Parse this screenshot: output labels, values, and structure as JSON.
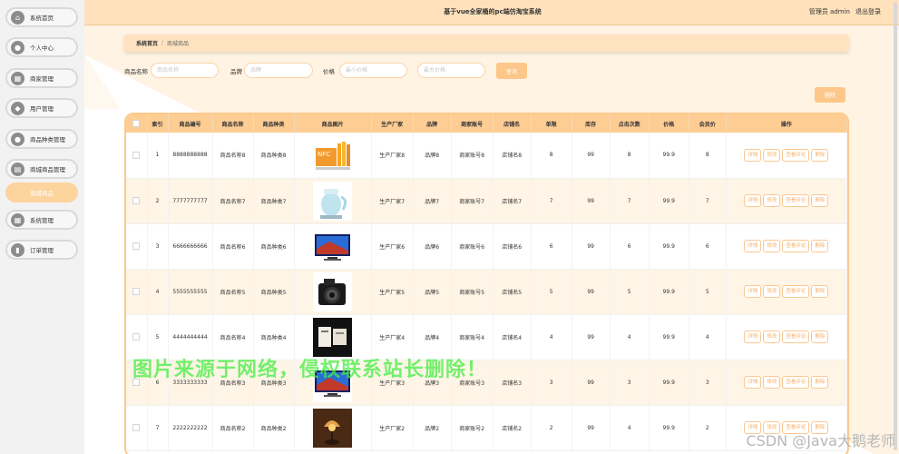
{
  "header": {
    "title": "基于vue全家桶的pc端仿淘宝系统",
    "user": "管理员 admin",
    "logout": "退出登录"
  },
  "sidebar": {
    "items": [
      {
        "label": "系统首页",
        "icon": "home-icon",
        "glyph": "⌂"
      },
      {
        "label": "个人中心",
        "icon": "user-icon",
        "glyph": "●"
      },
      {
        "label": "商家管理",
        "icon": "grid-icon",
        "glyph": "▦"
      },
      {
        "label": "用户管理",
        "icon": "location-icon",
        "glyph": "◆"
      },
      {
        "label": "商品种类管理",
        "icon": "user-icon",
        "glyph": "●"
      },
      {
        "label": "商城商品管理",
        "icon": "document-icon",
        "glyph": "▤"
      },
      {
        "label": "系统管理",
        "icon": "grid-icon",
        "glyph": "▦"
      },
      {
        "label": "订单管理",
        "icon": "chart-icon",
        "glyph": "▮"
      }
    ],
    "sub_item": "商城商品"
  },
  "breadcrumb": {
    "home": "系统首页",
    "separator": "/",
    "current": "商城商品"
  },
  "search": {
    "name_label": "商品名称",
    "name_placeholder": "商品名称",
    "brand_label": "品牌",
    "brand_placeholder": "品牌",
    "price_label": "价格",
    "min_placeholder": "最小价格",
    "max_placeholder": "最大价格",
    "query_button": "查询"
  },
  "delete_button": "删除",
  "table": {
    "columns": [
      "索引",
      "商品编号",
      "商品名称",
      "商品种类",
      "商品图片",
      "生产厂家",
      "品牌",
      "商家账号",
      "店铺名",
      "单限",
      "库存",
      "点击次数",
      "价格",
      "会员价",
      "操作"
    ],
    "actions": [
      "详情",
      "修改",
      "查看评论",
      "删除"
    ],
    "rows": [
      {
        "index": "1",
        "code": "8888888888",
        "name": "商品名称8",
        "category": "商品种类8",
        "image": "drinks",
        "maker": "生产厂家8",
        "brand": "品牌8",
        "account": "商家账号8",
        "shop": "店铺名8",
        "limit": "8",
        "stock": "99",
        "clicks": "8",
        "price": "99.9",
        "vip": "8"
      },
      {
        "index": "2",
        "code": "7777777777",
        "name": "商品名称7",
        "category": "商品种类7",
        "image": "kettle",
        "maker": "生产厂家7",
        "brand": "品牌7",
        "account": "商家账号7",
        "shop": "店铺名7",
        "limit": "7",
        "stock": "99",
        "clicks": "7",
        "price": "99.9",
        "vip": "7"
      },
      {
        "index": "3",
        "code": "6666666666",
        "name": "商品名称6",
        "category": "商品种类6",
        "image": "tv",
        "maker": "生产厂家6",
        "brand": "品牌6",
        "account": "商家账号6",
        "shop": "店铺名6",
        "limit": "6",
        "stock": "99",
        "clicks": "6",
        "price": "99.9",
        "vip": "6"
      },
      {
        "index": "4",
        "code": "5555555555",
        "name": "商品名称5",
        "category": "商品种类5",
        "image": "camera",
        "maker": "生产厂家5",
        "brand": "品牌5",
        "account": "商家账号5",
        "shop": "店铺名5",
        "limit": "5",
        "stock": "99",
        "clicks": "5",
        "price": "99.9",
        "vip": "5"
      },
      {
        "index": "5",
        "code": "4444444444",
        "name": "商品名称4",
        "category": "商品种类4",
        "image": "book",
        "maker": "生产厂家4",
        "brand": "品牌4",
        "account": "商家账号4",
        "shop": "店铺名4",
        "limit": "4",
        "stock": "99",
        "clicks": "4",
        "price": "99.9",
        "vip": "4"
      },
      {
        "index": "6",
        "code": "3333333333",
        "name": "商品名称3",
        "category": "商品种类3",
        "image": "tv",
        "maker": "生产厂家3",
        "brand": "品牌3",
        "account": "商家账号3",
        "shop": "店铺名3",
        "limit": "3",
        "stock": "99",
        "clicks": "3",
        "price": "99.9",
        "vip": "3"
      },
      {
        "index": "7",
        "code": "2222222222",
        "name": "商品名称2",
        "category": "商品种类2",
        "image": "lamp",
        "maker": "生产厂家2",
        "brand": "品牌2",
        "account": "商家账号2",
        "shop": "店铺名2",
        "limit": "2",
        "stock": "99",
        "clicks": "4",
        "price": "99.9",
        "vip": "2"
      }
    ]
  },
  "watermark": "图片来源于网络，侵权联系站长删除！",
  "credit": "CSDN @Java大鹅老师",
  "colors": {
    "accent": "#fdc78a",
    "header_bg": "#ffe2bb",
    "table_header": "#fecd94",
    "border": "#fcc98d"
  }
}
